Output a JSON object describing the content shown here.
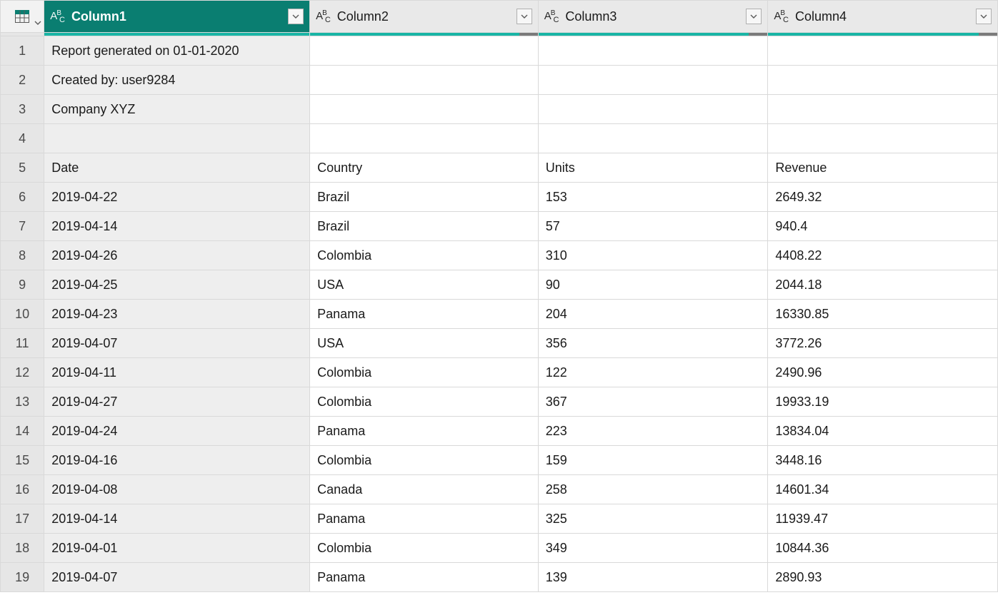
{
  "columns": {
    "c1": "Column1",
    "c2": "Column2",
    "c3": "Column3",
    "c4": "Column4"
  },
  "type_label": "ABC",
  "rows": [
    {
      "n": "1",
      "c1": "Report generated on 01-01-2020",
      "c2": "",
      "c3": "",
      "c4": ""
    },
    {
      "n": "2",
      "c1": "Created by: user9284",
      "c2": "",
      "c3": "",
      "c4": ""
    },
    {
      "n": "3",
      "c1": "Company XYZ",
      "c2": "",
      "c3": "",
      "c4": ""
    },
    {
      "n": "4",
      "c1": "",
      "c2": "",
      "c3": "",
      "c4": ""
    },
    {
      "n": "5",
      "c1": "Date",
      "c2": "Country",
      "c3": "Units",
      "c4": "Revenue"
    },
    {
      "n": "6",
      "c1": "2019-04-22",
      "c2": "Brazil",
      "c3": "153",
      "c4": "2649.32"
    },
    {
      "n": "7",
      "c1": "2019-04-14",
      "c2": "Brazil",
      "c3": "57",
      "c4": "940.4"
    },
    {
      "n": "8",
      "c1": "2019-04-26",
      "c2": "Colombia",
      "c3": "310",
      "c4": "4408.22"
    },
    {
      "n": "9",
      "c1": "2019-04-25",
      "c2": "USA",
      "c3": "90",
      "c4": "2044.18"
    },
    {
      "n": "10",
      "c1": "2019-04-23",
      "c2": "Panama",
      "c3": "204",
      "c4": "16330.85"
    },
    {
      "n": "11",
      "c1": "2019-04-07",
      "c2": "USA",
      "c3": "356",
      "c4": "3772.26"
    },
    {
      "n": "12",
      "c1": "2019-04-11",
      "c2": "Colombia",
      "c3": "122",
      "c4": "2490.96"
    },
    {
      "n": "13",
      "c1": "2019-04-27",
      "c2": "Colombia",
      "c3": "367",
      "c4": "19933.19"
    },
    {
      "n": "14",
      "c1": "2019-04-24",
      "c2": "Panama",
      "c3": "223",
      "c4": "13834.04"
    },
    {
      "n": "15",
      "c1": "2019-04-16",
      "c2": "Colombia",
      "c3": "159",
      "c4": "3448.16"
    },
    {
      "n": "16",
      "c1": "2019-04-08",
      "c2": "Canada",
      "c3": "258",
      "c4": "14601.34"
    },
    {
      "n": "17",
      "c1": "2019-04-14",
      "c2": "Panama",
      "c3": "325",
      "c4": "11939.47"
    },
    {
      "n": "18",
      "c1": "2019-04-01",
      "c2": "Colombia",
      "c3": "349",
      "c4": "10844.36"
    },
    {
      "n": "19",
      "c1": "2019-04-07",
      "c2": "Panama",
      "c3": "139",
      "c4": "2890.93"
    }
  ]
}
